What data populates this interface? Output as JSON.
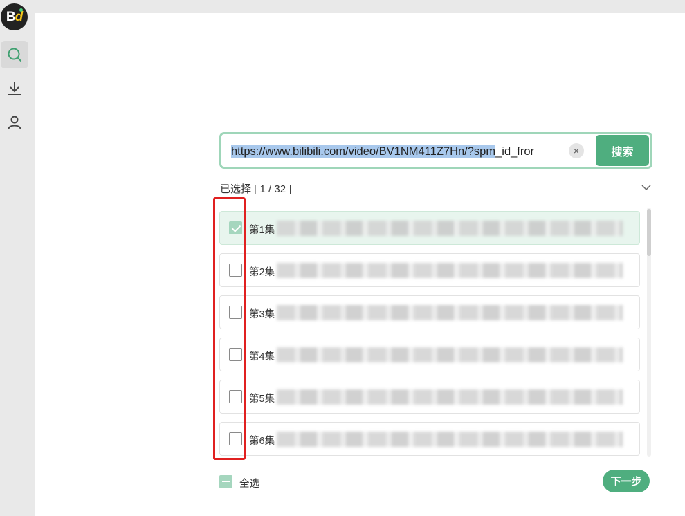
{
  "app": {
    "logo_text_b": "B",
    "logo_text_d": "d"
  },
  "sidebar": {
    "items": [
      {
        "name": "search",
        "icon": "search-icon",
        "active": true
      },
      {
        "name": "download",
        "icon": "download-icon",
        "active": false
      },
      {
        "name": "user",
        "icon": "user-icon",
        "active": false
      }
    ]
  },
  "search": {
    "value_selected": "https://www.bilibili.com/video/BV1NM411Z7Hn/?spm",
    "value_rest": "_id_fror",
    "clear_symbol": "×",
    "button_label": "搜索"
  },
  "selection": {
    "label": "已选择 [ 1 / 32 ]"
  },
  "episodes": [
    {
      "label": "第1集",
      "checked": true
    },
    {
      "label": "第2集",
      "checked": false
    },
    {
      "label": "第3集",
      "checked": false
    },
    {
      "label": "第4集",
      "checked": false
    },
    {
      "label": "第5集",
      "checked": false
    },
    {
      "label": "第6集",
      "checked": false
    }
  ],
  "footer": {
    "select_all_label": "全选",
    "next_label": "下一步"
  },
  "colors": {
    "accent": "#4fae7f",
    "highlight": "#e02020",
    "search_border": "#9fd6b9"
  }
}
